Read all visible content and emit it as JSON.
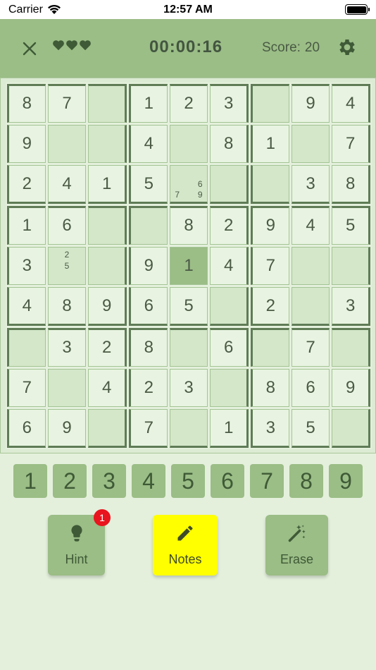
{
  "status_bar": {
    "carrier": "Carrier",
    "time": "12:57 AM"
  },
  "header": {
    "timer": "00:00:16",
    "score_label": "Score:",
    "score_value": "20",
    "lives": 3,
    "icons": {
      "close": "close-icon",
      "heart": "heart-icon",
      "settings": "gear-icon"
    }
  },
  "board": {
    "selected": [
      4,
      4
    ],
    "rows": [
      [
        "8",
        "7",
        "",
        "1",
        "2",
        "3",
        "",
        "9",
        "4"
      ],
      [
        "9",
        "",
        "",
        "4",
        "",
        "8",
        "1",
        "",
        "7"
      ],
      [
        "2",
        "4",
        "1",
        "5",
        "",
        "",
        "",
        "3",
        "8"
      ],
      [
        "1",
        "6",
        "",
        "",
        "8",
        "2",
        "9",
        "4",
        "5"
      ],
      [
        "3",
        "",
        "",
        "9",
        "1",
        "4",
        "7",
        "",
        ""
      ],
      [
        "4",
        "8",
        "9",
        "6",
        "5",
        "",
        "2",
        "",
        "3"
      ],
      [
        "",
        "3",
        "2",
        "8",
        "",
        "6",
        "",
        "7",
        ""
      ],
      [
        "7",
        "",
        "4",
        "2",
        "3",
        "",
        "8",
        "6",
        "9"
      ],
      [
        "6",
        "9",
        "",
        "7",
        "",
        "1",
        "3",
        "5",
        ""
      ]
    ],
    "notes": {
      "2-4": [
        "",
        "",
        "",
        "",
        "",
        "6",
        "7",
        "",
        "9"
      ],
      "4-1": [
        "",
        "2",
        "",
        "",
        "5",
        "",
        "",
        "",
        ""
      ]
    }
  },
  "numpad": [
    "1",
    "2",
    "3",
    "4",
    "5",
    "6",
    "7",
    "8",
    "9"
  ],
  "tools": {
    "hint": {
      "label": "Hint",
      "badge": "1",
      "icon": "lightbulb-icon"
    },
    "notes": {
      "label": "Notes",
      "icon": "pencil-icon"
    },
    "erase": {
      "label": "Erase",
      "icon": "magic-wand-icon"
    }
  },
  "colors": {
    "background": "#e4f0dc",
    "accent": "#9bbd86",
    "notes_active": "#ffff00",
    "badge": "#e8141e"
  }
}
